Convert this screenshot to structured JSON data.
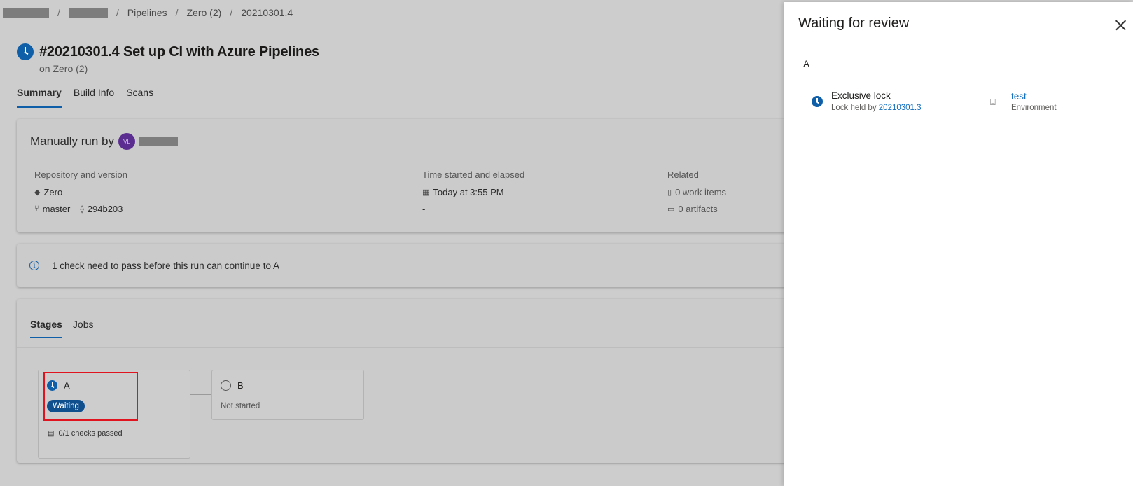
{
  "breadcrumb": {
    "items": [
      "Pipelines",
      "Zero (2)",
      "20210301.4"
    ]
  },
  "run": {
    "title": "#20210301.4 Set up CI with Azure Pipelines",
    "subtitle": "on Zero (2)"
  },
  "tabs": [
    "Summary",
    "Build Info",
    "Scans"
  ],
  "summary": {
    "manual_run_label": "Manually run by",
    "avatar_initials": "VL",
    "repo_label": "Repository and version",
    "repo_name": "Zero",
    "branch": "master",
    "commit": "294b203",
    "time_label": "Time started and elapsed",
    "time_started": "Today at 3:55 PM",
    "elapsed": "-",
    "related_label": "Related",
    "work_items": "0 work items",
    "artifacts": "0 artifacts"
  },
  "check_notice": "1 check need to pass before this run can continue to A",
  "stages_tabs": [
    "Stages",
    "Jobs"
  ],
  "stages": [
    {
      "name": "A",
      "status": "Waiting",
      "checks": "0/1 checks passed"
    },
    {
      "name": "B",
      "status": "Not started"
    }
  ],
  "panel": {
    "title": "Waiting for review",
    "stage": "A",
    "lock": {
      "title": "Exclusive lock",
      "held_by_label": "Lock held by",
      "held_by_run": "20210301.3",
      "environment_name": "test",
      "environment_label": "Environment"
    }
  },
  "colors": {
    "accent": "#0f5ea8",
    "link": "#0f6cbd",
    "highlight": "#e0141e",
    "avatar": "#5c2d91"
  }
}
